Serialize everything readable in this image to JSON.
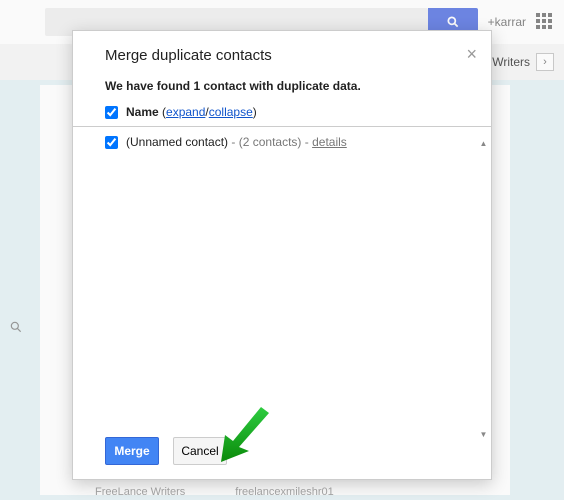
{
  "background": {
    "username": "+karrar",
    "secondbar_text": "Writers"
  },
  "dialog": {
    "title": "Merge duplicate contacts",
    "subtitle": "We have found 1 contact with duplicate data.",
    "name_row": {
      "label": "Name",
      "open_paren": "(",
      "expand": "expand",
      "slash": "/",
      "collapse": "collapse",
      "close_paren": ")"
    },
    "contact_row": {
      "name": "(Unnamed contact)",
      "count": "- (2 contacts) -",
      "details": "details"
    },
    "buttons": {
      "merge": "Merge",
      "cancel": "Cancel"
    }
  },
  "footer": {
    "left": "FreeLance Writers",
    "right": "freelancexmileshr01"
  }
}
